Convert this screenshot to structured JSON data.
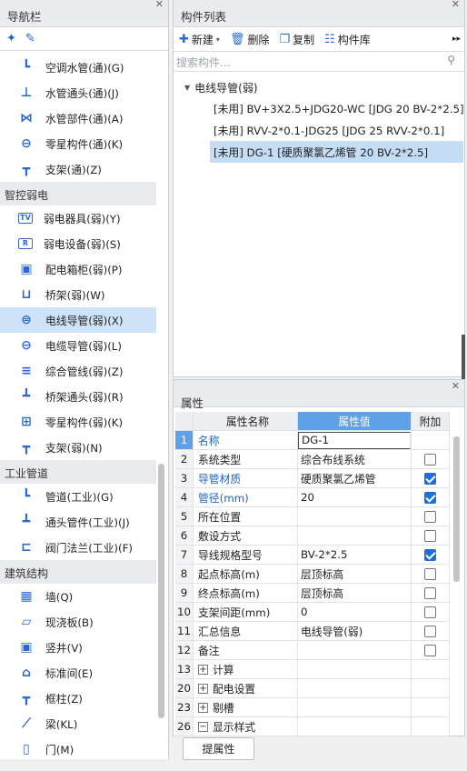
{
  "nav": {
    "title": "导航栏",
    "groups_top": [
      {
        "label": "空调水管(通)(G)",
        "icon": "pipe-icon"
      },
      {
        "label": "水管通头(通)(J)",
        "icon": "fitting-icon"
      },
      {
        "label": "水管部件(通)(A)",
        "icon": "valve-icon"
      },
      {
        "label": "零星构件(通)(K)",
        "icon": "part-icon"
      },
      {
        "label": "支架(通)(Z)",
        "icon": "bracket-icon"
      }
    ],
    "group_weak": "智控弱电",
    "weak_items": [
      {
        "label": "弱电器具(弱)(Y)",
        "icon": "tv-icon",
        "glyph": "TV"
      },
      {
        "label": "弱电设备(弱)(S)",
        "icon": "device-icon",
        "glyph": "R"
      },
      {
        "label": "配电箱柜(弱)(P)",
        "icon": "cabinet-icon",
        "glyph": "▣"
      },
      {
        "label": "桥架(弱)(W)",
        "icon": "tray-icon",
        "glyph": "⊔"
      },
      {
        "label": "电线导管(弱)(X)",
        "icon": "conduit-icon",
        "glyph": "⊜"
      },
      {
        "label": "电缆导管(弱)(L)",
        "icon": "cable-conduit-icon",
        "glyph": "⊖"
      },
      {
        "label": "综合管线(弱)(Z)",
        "icon": "pipeline-icon",
        "glyph": "≡"
      },
      {
        "label": "桥架通头(弱)(R)",
        "icon": "tray-fitting-icon",
        "glyph": "┻"
      },
      {
        "label": "零星构件(弱)(K)",
        "icon": "part-icon",
        "glyph": "⊞"
      },
      {
        "label": "支架(弱)(N)",
        "icon": "bracket-icon",
        "glyph": "┳"
      }
    ],
    "group_industrial": "工业管道",
    "industrial_items": [
      {
        "label": "管道(工业)(G)",
        "glyph": "┗"
      },
      {
        "label": "通头管件(工业)(J)",
        "glyph": "┻"
      },
      {
        "label": "阀门法兰(工业)(F)",
        "glyph": "⊏"
      }
    ],
    "group_structure": "建筑结构",
    "structure_items": [
      {
        "label": "墙(Q)",
        "glyph": "▦"
      },
      {
        "label": "现浇板(B)",
        "glyph": "▱"
      },
      {
        "label": "竖井(V)",
        "glyph": "▣"
      },
      {
        "label": "标准间(E)",
        "glyph": "⌂"
      },
      {
        "label": "框柱(Z)",
        "glyph": "┳"
      },
      {
        "label": "梁(KL)",
        "glyph": "⟋"
      },
      {
        "label": "门(M)",
        "glyph": "▯"
      }
    ]
  },
  "comp": {
    "title": "构件列表",
    "new": "新建",
    "delete": "删除",
    "copy": "复制",
    "library": "构件库",
    "search_placeholder": "搜索构件...",
    "root": "电线导管(弱)",
    "leaves": [
      "[未用] BV+3X2.5+JDG20-WC [JDG 20 BV-2*2.5]",
      "[未用] RVV-2*0.1-JDG25 [JDG 25 RVV-2*0.1]",
      "[未用] DG-1 [硬质聚氯乙烯管 20 BV-2*2.5]"
    ]
  },
  "prop": {
    "title": "属性",
    "col_name": "属性名称",
    "col_value": "属性值",
    "col_extra": "附加",
    "rows": [
      {
        "no": "1",
        "name": "名称",
        "value": "DG-1",
        "check": null,
        "blue": true
      },
      {
        "no": "2",
        "name": "系统类型",
        "value": "综合布线系统",
        "check": false,
        "blue": false
      },
      {
        "no": "3",
        "name": "导管材质",
        "value": "硬质聚氯乙烯管",
        "check": true,
        "blue": true
      },
      {
        "no": "4",
        "name": "管径(mm)",
        "value": "20",
        "check": true,
        "blue": true
      },
      {
        "no": "5",
        "name": "所在位置",
        "value": "",
        "check": false,
        "blue": false
      },
      {
        "no": "6",
        "name": "敷设方式",
        "value": "",
        "check": false,
        "blue": false
      },
      {
        "no": "7",
        "name": "导线规格型号",
        "value": "BV-2*2.5",
        "check": true,
        "blue": false
      },
      {
        "no": "8",
        "name": "起点标高(m)",
        "value": "层顶标高",
        "check": false,
        "blue": false
      },
      {
        "no": "9",
        "name": "终点标高(m)",
        "value": "层顶标高",
        "check": false,
        "blue": false
      },
      {
        "no": "10",
        "name": "支架间距(mm)",
        "value": "0",
        "check": false,
        "blue": false
      },
      {
        "no": "11",
        "name": "汇总信息",
        "value": "电线导管(弱)",
        "check": false,
        "blue": false
      },
      {
        "no": "12",
        "name": "备注",
        "value": "",
        "check": false,
        "blue": false
      },
      {
        "no": "13",
        "name": "计算",
        "value": "",
        "check": null,
        "blue": false,
        "group": "+"
      },
      {
        "no": "20",
        "name": "配电设置",
        "value": "",
        "check": null,
        "blue": false,
        "group": "+"
      },
      {
        "no": "23",
        "name": "剔槽",
        "value": "",
        "check": null,
        "blue": false,
        "group": "+"
      },
      {
        "no": "26",
        "name": "显示样式",
        "value": "",
        "check": null,
        "blue": false,
        "group": "−"
      }
    ],
    "button": "提属性"
  }
}
